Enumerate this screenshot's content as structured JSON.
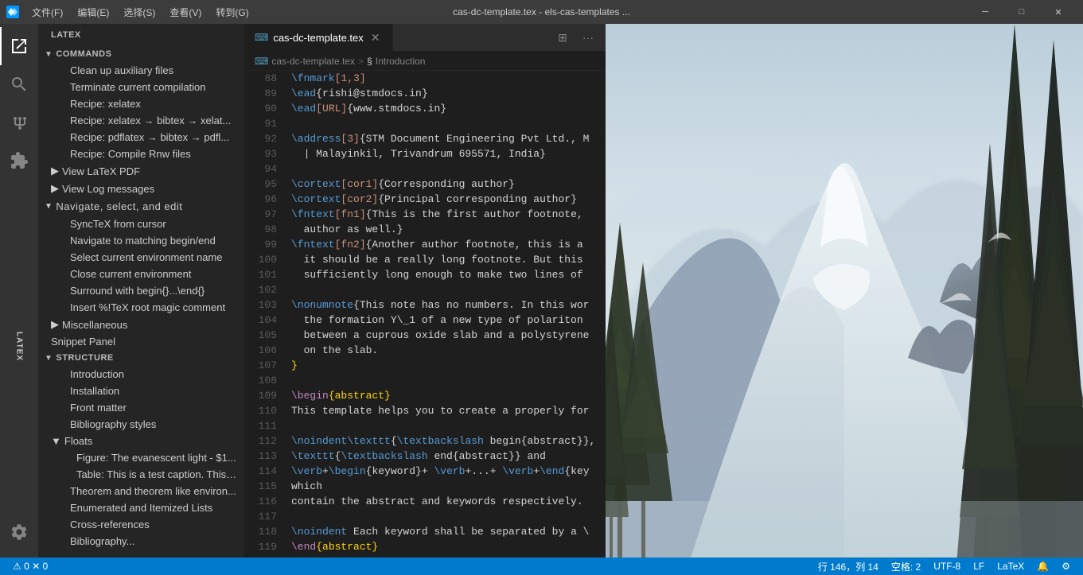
{
  "titlebar": {
    "logo": "◆",
    "menus": [
      "文件(F)",
      "编辑(E)",
      "选择(S)",
      "查看(V)",
      "转到(G)"
    ],
    "title": "cas-dc-template.tex - els-cas-templates ...",
    "controls": {
      "minimize": "─",
      "maximize": "□",
      "close": "✕"
    }
  },
  "sidebar_header": "LATEX",
  "sections": {
    "commands": {
      "label": "COMMANDS",
      "items": [
        "Clean up auxiliary files",
        "Terminate current compilation",
        "Recipe: xelatex",
        "Recipe: xelatex → bibtex → xelat...",
        "Recipe: pdflatex → bibtex → pdfl...",
        "Recipe: Compile Rnw files"
      ]
    },
    "view": {
      "items": [
        "View LaTeX PDF",
        "View Log messages"
      ]
    },
    "navigate": {
      "label": "Navigate, select, and edit",
      "items": [
        "SyncTeX from cursor",
        "Navigate to matching begin/end",
        "Select current environment name",
        "Close current environment",
        "Surround with begin{}...\\end{}",
        "Insert %!TeX root magic comment"
      ]
    },
    "miscellaneous": "Miscellaneous",
    "snippet_panel": "Snippet Panel",
    "structure": {
      "label": "STRUCTURE",
      "items": [
        "Introduction",
        "Installation",
        "Front matter",
        "Bibliography styles"
      ],
      "floats": {
        "label": "Floats",
        "items": [
          "Figure:  The evanescent light - $1...",
          "Table:  This is a test caption. This i..."
        ]
      },
      "more_items": [
        "Theorem and theorem like environ...",
        "Enumerated and Itemized Lists",
        "Cross-references",
        "Bibliography..."
      ]
    }
  },
  "tab": {
    "icon": "⌨",
    "filename": "cas-dc-template.tex",
    "close": "✕"
  },
  "breadcrumb": {
    "file": "cas-dc-template.tex",
    "sep": ">",
    "section_icon": "§",
    "section": "Introduction"
  },
  "code_lines": [
    {
      "num": "88",
      "content": "\\fnmark[1,3]",
      "type": "command"
    },
    {
      "num": "89",
      "content": "\\ead{rishi@stmdocs.in}",
      "type": "command"
    },
    {
      "num": "90",
      "content": "\\ead[URL]{www.stmdocs.in}",
      "type": "command"
    },
    {
      "num": "91",
      "content": "",
      "type": "empty"
    },
    {
      "num": "92",
      "content": "\\address[3]{STM Document Engineering Pvt Ltd., M",
      "type": "command"
    },
    {
      "num": "93",
      "content": "  | Malayinkil, Trivandrum 695571, India}",
      "type": "text"
    },
    {
      "num": "94",
      "content": "",
      "type": "empty"
    },
    {
      "num": "95",
      "content": "\\cortext[cor1]{Corresponding author}",
      "type": "command"
    },
    {
      "num": "96",
      "content": "\\cortext[cor2]{Principal corresponding author}",
      "type": "command"
    },
    {
      "num": "97",
      "content": "\\fntext[fn1]{This is the first author footnote,",
      "type": "command"
    },
    {
      "num": "98",
      "content": "  author as well.}",
      "type": "text"
    },
    {
      "num": "99",
      "content": "\\fntext[fn2]{Another author footnote, this is a",
      "type": "command"
    },
    {
      "num": "100",
      "content": "  it should be a really long footnote. But this",
      "type": "text"
    },
    {
      "num": "101",
      "content": "  sufficiently long enough to make two lines of",
      "type": "text"
    },
    {
      "num": "102",
      "content": "",
      "type": "empty"
    },
    {
      "num": "103",
      "content": "\\nonumnote{This note has no numbers. In this wor",
      "type": "command"
    },
    {
      "num": "104",
      "content": "  the formation Y\\_1 of a new type of polariton",
      "type": "text"
    },
    {
      "num": "105",
      "content": "  between a cuprous oxide slab and a polystyrene",
      "type": "text"
    },
    {
      "num": "106",
      "content": "  on the slab.",
      "type": "text"
    },
    {
      "num": "107",
      "content": "}",
      "type": "brace"
    },
    {
      "num": "108",
      "content": "",
      "type": "empty"
    },
    {
      "num": "109",
      "content": "\\begin{abstract}",
      "type": "env"
    },
    {
      "num": "110",
      "content": "This template helps you to create a properly for",
      "type": "text"
    },
    {
      "num": "111",
      "content": "",
      "type": "empty"
    },
    {
      "num": "112",
      "content": "\\noindent\\texttt{\\textbackslash begin{abstract}},",
      "type": "command"
    },
    {
      "num": "113",
      "content": "\\texttt{\\textbackslash end{abstract}} and",
      "type": "command"
    },
    {
      "num": "114",
      "content": "\\verb+\\begin{keyword}+ \\verb+...+ \\verb+\\end{key",
      "type": "command"
    },
    {
      "num": "115",
      "content": "which",
      "type": "text"
    },
    {
      "num": "116",
      "content": "contain the abstract and keywords respectively.",
      "type": "text"
    },
    {
      "num": "117",
      "content": "",
      "type": "empty"
    },
    {
      "num": "118",
      "content": "\\noindent Each keyword shall be separated by a \\",
      "type": "command"
    },
    {
      "num": "119",
      "content": "\\end{abstract}",
      "type": "env"
    }
  ],
  "status_bar": {
    "problems": "⚠ 0  ✕ 0",
    "position": "行 146，列 14",
    "spaces": "空格: 2",
    "encoding": "UTF-8",
    "line_ending": "LF",
    "language": "LaTeX",
    "feedback": "🔔",
    "remote": "⚙"
  }
}
